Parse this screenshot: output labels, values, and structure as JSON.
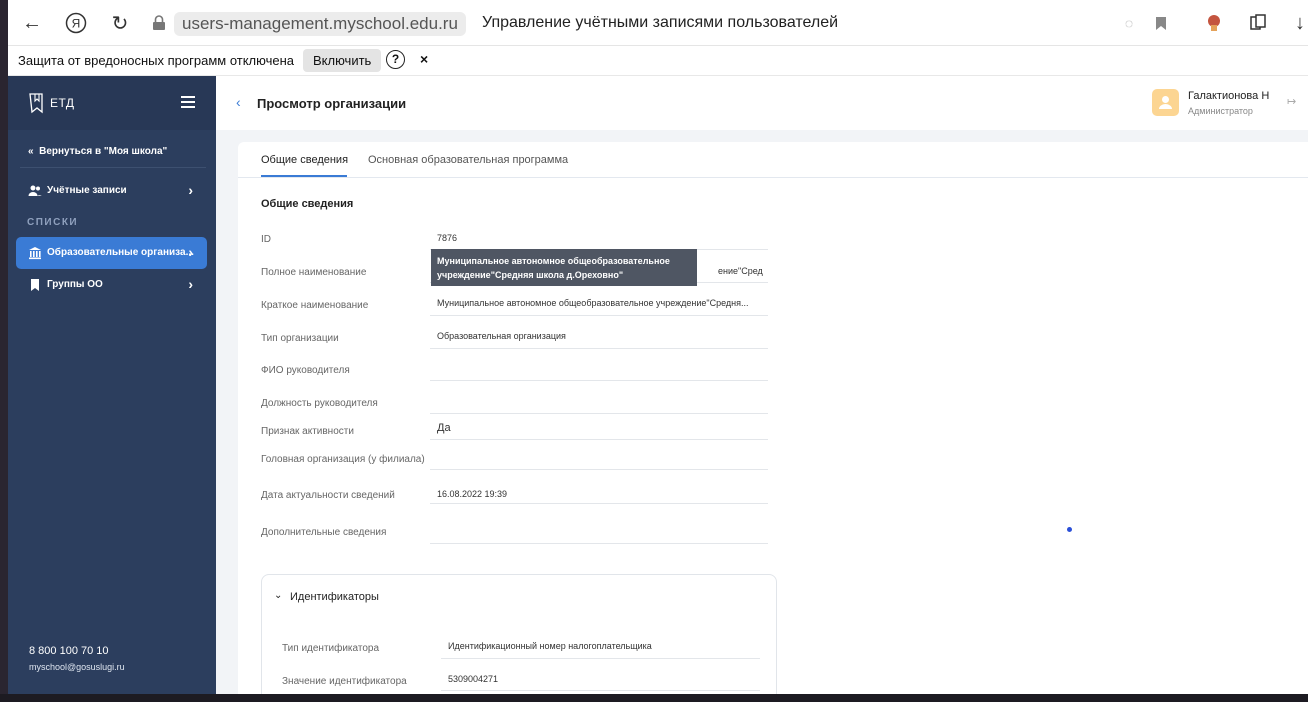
{
  "browser": {
    "url": "users-management.myschool.edu.ru",
    "tab_title": "Управление учётными записями пользователей"
  },
  "notice": {
    "text": "Защита от вредоносных программ отключена",
    "enable_label": "Включить",
    "help_label": "?",
    "close_label": "×"
  },
  "sidebar": {
    "logo_text": "ЕТД",
    "back_link": "Вернуться в \"Моя школа\"",
    "items": [
      {
        "label": "Учётные записи"
      },
      {
        "label": "Образовательные организа..."
      },
      {
        "label": "Группы ОО"
      }
    ],
    "section_label": "СПИСКИ",
    "phone": "8 800 100 70 10",
    "email": "myschool@gosuslugi.ru"
  },
  "header": {
    "title": "Просмотр организации",
    "user_name": "Галактионова Н",
    "user_role": "Администратор"
  },
  "tabs": [
    {
      "label": "Общие сведения",
      "active": true
    },
    {
      "label": "Основная образовательная программа",
      "active": false
    }
  ],
  "section_title": "Общие сведения",
  "fields": [
    {
      "label": "ID",
      "value": "7876"
    },
    {
      "label": "Полное наименование",
      "value": "ение\"Средня..."
    },
    {
      "label": "Краткое наименование",
      "value": "Муниципальное автономное общеобразовательное учреждение\"Средня..."
    },
    {
      "label": "Тип организации",
      "value": "Образовательная организация"
    },
    {
      "label": "ФИО руководителя",
      "value": ""
    },
    {
      "label": "Должность руководителя",
      "value": ""
    },
    {
      "label": "Признак активности",
      "value": "Да"
    },
    {
      "label": "Головная организация (у филиала)",
      "value": ""
    },
    {
      "label": "Дата актуальности сведений",
      "value": "16.08.2022 19:39"
    },
    {
      "label": "Дополнительные сведения",
      "value": ""
    }
  ],
  "tooltip": {
    "line1": "Муниципальное автономное общеобразовательное",
    "line2": "учреждение\"Средняя школа д.Ореховно\""
  },
  "identifiers": {
    "title": "Идентификаторы",
    "rows": [
      {
        "label": "Тип идентификатора",
        "value": "Идентификационный номер налогоплательщика"
      },
      {
        "label": "Значение идентификатора",
        "value": "5309004271"
      }
    ]
  }
}
